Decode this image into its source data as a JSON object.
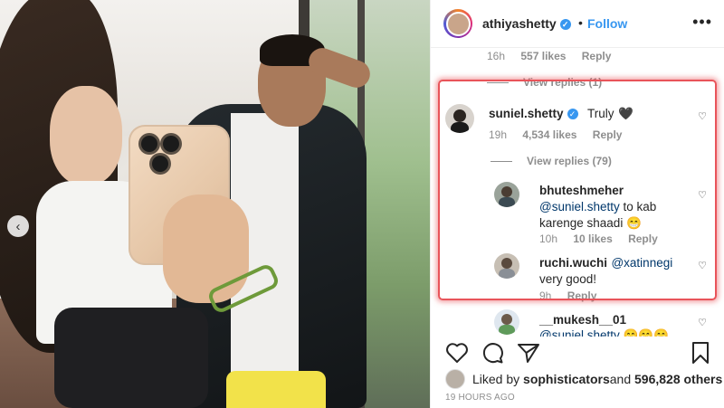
{
  "photo": {
    "carousel_prev": "‹"
  },
  "header": {
    "username": "athiyashetty",
    "dot": "•",
    "follow": "Follow",
    "more": "•••"
  },
  "comments": {
    "prev_meta": {
      "time": "16h",
      "likes": "557 likes",
      "reply": "Reply"
    },
    "view_replies_1": "View replies (1)",
    "main": {
      "username": "suniel.shetty",
      "text": "Truly",
      "emoji": "🖤",
      "time": "19h",
      "likes": "4,534 likes",
      "reply": "Reply",
      "view_replies": "View replies (79)"
    },
    "replies": [
      {
        "username": "bhuteshmeher",
        "mention": "@suniel.shetty",
        "text": " to kab karenge shaadi",
        "emoji": "😁",
        "time": "10h",
        "likes": "10 likes",
        "reply": "Reply"
      },
      {
        "username": "ruchi.wuchi",
        "mention": "@xatinnegi",
        "text": "very good!",
        "time": "9h",
        "reply": "Reply"
      }
    ],
    "next": {
      "username": "__mukesh__01",
      "mention": "@suniel.shetty",
      "emoji": "😁😁😁"
    }
  },
  "likes": {
    "prefix": "Liked by ",
    "user": "sophisticators",
    "and": " and ",
    "count": "596,828 others"
  },
  "timestamp": "19 HOURS AGO",
  "colors": {
    "accent": "#3897f0",
    "highlight": "#e8545a",
    "mention": "#00376b"
  }
}
